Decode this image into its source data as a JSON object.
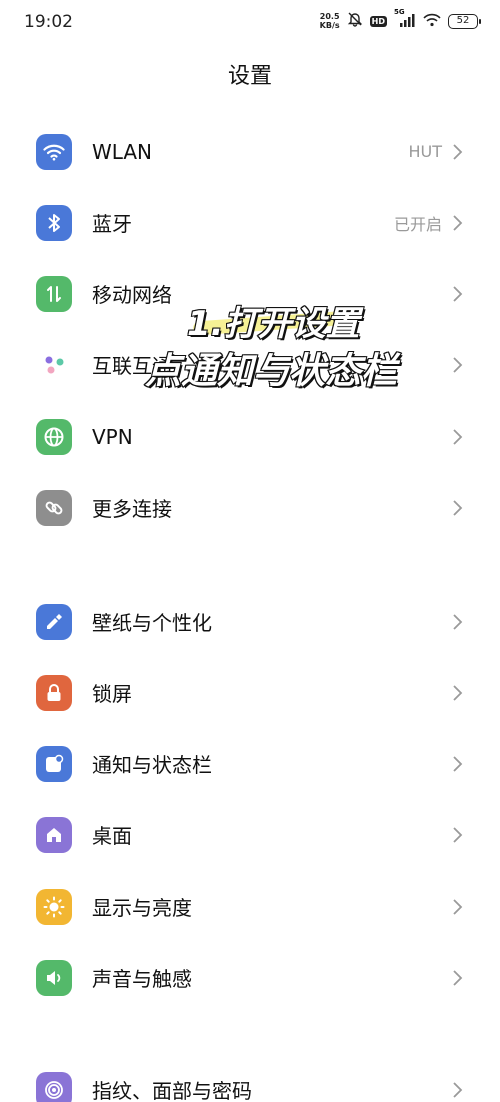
{
  "status_bar": {
    "time": "19:02",
    "net_speed_value": "20.5",
    "net_speed_unit": "KB/s",
    "hd_badge": "HD",
    "network_type": "5G",
    "battery": "52"
  },
  "page": {
    "title": "设置"
  },
  "group1": [
    {
      "label": "WLAN",
      "value": "HUT",
      "icon": "wifi-icon",
      "color": "#4a78d8"
    },
    {
      "label": "蓝牙",
      "value": "已开启",
      "icon": "bluetooth-icon",
      "color": "#4a78d8"
    },
    {
      "label": "移动网络",
      "value": "",
      "icon": "mobile-data-icon",
      "color": "#54b96a"
    },
    {
      "label": "互联互通",
      "value": "",
      "icon": "interconnect-icon",
      "color": "#ffffff"
    },
    {
      "label": "VPN",
      "value": "",
      "icon": "globe-icon",
      "color": "#54b96a"
    },
    {
      "label": "更多连接",
      "value": "",
      "icon": "link-icon",
      "color": "#8e8e8e"
    }
  ],
  "group2": [
    {
      "label": "壁纸与个性化",
      "value": "",
      "icon": "brush-icon",
      "color": "#4a78d8"
    },
    {
      "label": "锁屏",
      "value": "",
      "icon": "lock-icon",
      "color": "#e0663e"
    },
    {
      "label": "通知与状态栏",
      "value": "",
      "icon": "notification-icon",
      "color": "#4a78d8"
    },
    {
      "label": "桌面",
      "value": "",
      "icon": "home-icon",
      "color": "#8a74d6"
    },
    {
      "label": "显示与亮度",
      "value": "",
      "icon": "sun-icon",
      "color": "#f2b632"
    },
    {
      "label": "声音与触感",
      "value": "",
      "icon": "speaker-icon",
      "color": "#54b96a"
    }
  ],
  "group3": [
    {
      "label": "指纹、面部与密码",
      "value": "",
      "icon": "fingerprint-icon",
      "color": "#8a74d6"
    }
  ],
  "overlay": {
    "line1": "1.打开设置",
    "line2": "点通知与状态栏"
  }
}
